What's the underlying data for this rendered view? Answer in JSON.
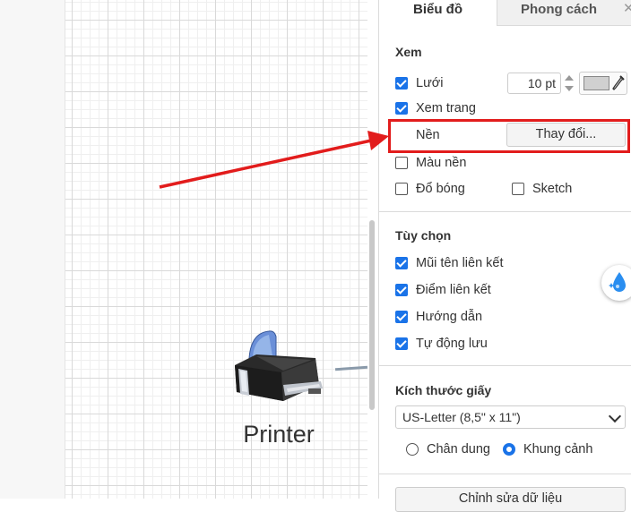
{
  "tabs": {
    "diagram": "Biểu đồ",
    "style": "Phong cách"
  },
  "view": {
    "title": "Xem",
    "grid_label": "Lưới",
    "grid_checked": true,
    "grid_size": "10 pt",
    "page_view_label": "Xem trang",
    "page_view_checked": true,
    "background_label": "Nền",
    "change_button": "Thay đổi...",
    "background_color_label": "Màu nền",
    "background_color_checked": false,
    "shadow_label": "Đổ bóng",
    "shadow_checked": false,
    "sketch_label": "Sketch",
    "sketch_checked": false
  },
  "options": {
    "title": "Tùy chọn",
    "items": [
      {
        "label": "Mũi tên liên kết",
        "checked": true
      },
      {
        "label": "Điểm liên kết",
        "checked": true
      },
      {
        "label": "Hướng dẫn",
        "checked": true
      },
      {
        "label": "Tự động lưu",
        "checked": true
      }
    ]
  },
  "paper": {
    "title": "Kích thước giấy",
    "selected": "US-Letter (8,5\" x 11\")",
    "portrait_label": "Chân dung",
    "landscape_label": "Khung cảnh",
    "orientation": "landscape"
  },
  "edit_data_button": "Chỉnh sửa dữ liệu",
  "canvas": {
    "shape_label": "Printer"
  },
  "colors": {
    "accent": "#1a73e8",
    "annotation": "#e21c1c",
    "grid_swatch": "#d0d0d0"
  }
}
